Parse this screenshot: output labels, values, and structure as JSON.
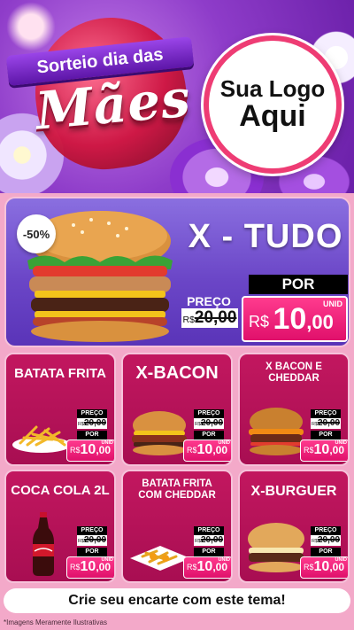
{
  "header": {
    "ribbon_text": "Sorteio dia das",
    "title": "Mães",
    "logo_line1": "Sua Logo",
    "logo_line2": "Aqui"
  },
  "featured": {
    "name": "X - TUDO",
    "discount": "-50%",
    "preco_label": "PREÇO",
    "old_currency": "R$",
    "old_price": "20,00",
    "por_label": "POR",
    "new_currency": "R$",
    "new_price_int": "10",
    "new_price_cents": ",00",
    "unit": "UNID"
  },
  "products": [
    {
      "name": "BATATA FRITA",
      "preco_label": "PREÇO",
      "old_currency": "R$",
      "old_price": "20,00",
      "por_label": "POR",
      "new_currency": "R$",
      "new_price_int": "10",
      "new_price_cents": ",00",
      "unit": "UNID"
    },
    {
      "name": "X-BACON",
      "preco_label": "PREÇO",
      "old_currency": "R$",
      "old_price": "20,00",
      "por_label": "POR",
      "new_currency": "R$",
      "new_price_int": "10",
      "new_price_cents": ",00",
      "unit": "UNID"
    },
    {
      "name": "X BACON E CHEDDAR",
      "preco_label": "PREÇO",
      "old_currency": "R$",
      "old_price": "20,00",
      "por_label": "POR",
      "new_currency": "R$",
      "new_price_int": "10",
      "new_price_cents": ",00",
      "unit": "UNID"
    },
    {
      "name": "COCA COLA 2L",
      "preco_label": "PREÇO",
      "old_currency": "R$",
      "old_price": "20,00",
      "por_label": "POR",
      "new_currency": "R$",
      "new_price_int": "10",
      "new_price_cents": ",00",
      "unit": "UNID"
    },
    {
      "name": "BATATA FRITA COM CHEDDAR",
      "preco_label": "PREÇO",
      "old_currency": "R$",
      "old_price": "20,00",
      "por_label": "POR",
      "new_currency": "R$",
      "new_price_int": "10",
      "new_price_cents": ",00",
      "unit": "UNID"
    },
    {
      "name": "X-BURGUER",
      "preco_label": "PREÇO",
      "old_currency": "R$",
      "old_price": "20,00",
      "por_label": "POR",
      "new_currency": "R$",
      "new_price_int": "10",
      "new_price_cents": ",00",
      "unit": "UNID"
    }
  ],
  "cta": "Crie seu encarte com este tema!",
  "disclaimer": "*Imagens Meramente Ilustrativas",
  "colors": {
    "accent_pink": "#e0106b",
    "card_bg": "#b01256",
    "hero_bg": "#6b46c7",
    "header_purple": "#8e3cc9"
  }
}
